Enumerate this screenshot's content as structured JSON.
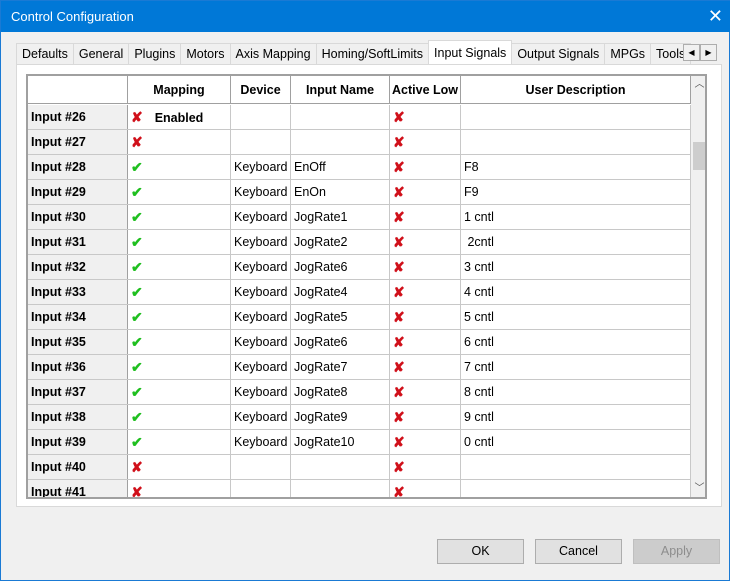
{
  "window": {
    "title": "Control Configuration",
    "close_icon": "close-icon"
  },
  "tabs": [
    "Defaults",
    "General",
    "Plugins",
    "Motors",
    "Axis Mapping",
    "Homing/SoftLimits",
    "Input Signals",
    "Output Signals",
    "MPGs",
    "Tools"
  ],
  "active_tab": "Input Signals",
  "grid": {
    "columns": [
      "",
      "Mapping Enabled",
      "Device",
      "Input Name",
      "Active Low",
      "User Description"
    ],
    "rows": [
      {
        "name": "Input #26",
        "enabled": false,
        "device": "",
        "input": "",
        "active_low": false,
        "desc": ""
      },
      {
        "name": "Input #27",
        "enabled": false,
        "device": "",
        "input": "",
        "active_low": false,
        "desc": ""
      },
      {
        "name": "Input #28",
        "enabled": true,
        "device": "Keyboard",
        "input": "EnOff",
        "active_low": false,
        "desc": "F8"
      },
      {
        "name": "Input #29",
        "enabled": true,
        "device": "Keyboard",
        "input": "EnOn",
        "active_low": false,
        "desc": "F9"
      },
      {
        "name": "Input #30",
        "enabled": true,
        "device": "Keyboard",
        "input": "JogRate1",
        "active_low": false,
        "desc": "1 cntl"
      },
      {
        "name": "Input #31",
        "enabled": true,
        "device": "Keyboard",
        "input": "JogRate2",
        "active_low": false,
        "desc": " 2cntl"
      },
      {
        "name": "Input #32",
        "enabled": true,
        "device": "Keyboard",
        "input": "JogRate6",
        "active_low": false,
        "desc": "3 cntl"
      },
      {
        "name": "Input #33",
        "enabled": true,
        "device": "Keyboard",
        "input": "JogRate4",
        "active_low": false,
        "desc": "4 cntl"
      },
      {
        "name": "Input #34",
        "enabled": true,
        "device": "Keyboard",
        "input": "JogRate5",
        "active_low": false,
        "desc": "5 cntl"
      },
      {
        "name": "Input #35",
        "enabled": true,
        "device": "Keyboard",
        "input": "JogRate6",
        "active_low": false,
        "desc": "6 cntl"
      },
      {
        "name": "Input #36",
        "enabled": true,
        "device": "Keyboard",
        "input": "JogRate7",
        "active_low": false,
        "desc": "7 cntl"
      },
      {
        "name": "Input #37",
        "enabled": true,
        "device": "Keyboard",
        "input": "JogRate8",
        "active_low": false,
        "desc": "8 cntl"
      },
      {
        "name": "Input #38",
        "enabled": true,
        "device": "Keyboard",
        "input": "JogRate9",
        "active_low": false,
        "desc": "9 cntl"
      },
      {
        "name": "Input #39",
        "enabled": true,
        "device": "Keyboard",
        "input": "JogRate10",
        "active_low": false,
        "desc": "0 cntl"
      },
      {
        "name": "Input #40",
        "enabled": false,
        "device": "",
        "input": "",
        "active_low": false,
        "desc": ""
      },
      {
        "name": "Input #41",
        "enabled": false,
        "device": "",
        "input": "",
        "active_low": false,
        "desc": ""
      }
    ]
  },
  "buttons": {
    "ok": "OK",
    "cancel": "Cancel",
    "apply": "Apply"
  },
  "colors": {
    "titlebar": "#0078d7",
    "check": "#1fbf1f",
    "cross": "#d0101a"
  },
  "glyphs": {
    "check": "✔",
    "cross": "✘"
  }
}
